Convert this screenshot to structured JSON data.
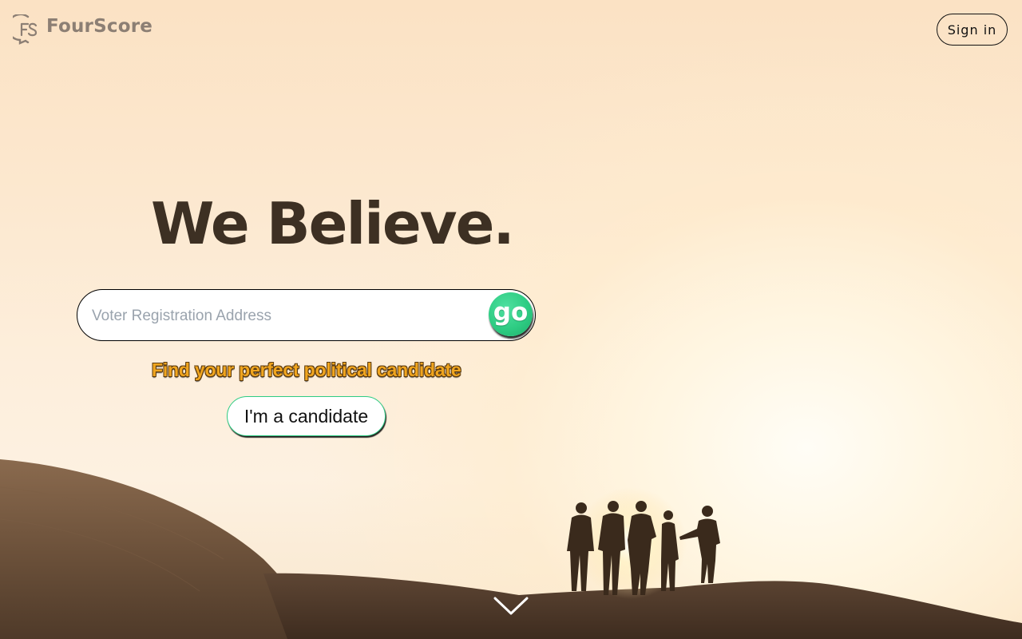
{
  "brand": {
    "name": "FourScore",
    "mark_text": "FS"
  },
  "header": {
    "signin_label": "Sign in"
  },
  "hero": {
    "headline": "We Believe.",
    "search": {
      "placeholder": "Voter Registration Address",
      "value": "",
      "go_label": "go"
    },
    "tagline": "Find your perfect political candidate",
    "candidate_button_label": "I'm a candidate",
    "scroll_icon": "chevron-down-icon"
  },
  "colors": {
    "accent_green": "#2ecc83",
    "headline_brown": "#3d3023",
    "tagline_orange": "#f0a51f",
    "logo_gray": "#8c7f74"
  }
}
